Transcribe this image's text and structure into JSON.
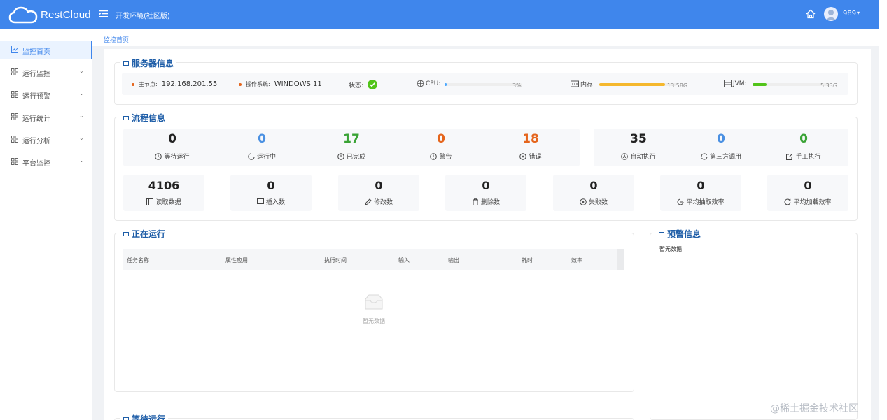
{
  "app": {
    "logo_text": "RestCloud",
    "env_title": "开发环境(社区版)",
    "user": "989"
  },
  "sidebar": {
    "items": [
      {
        "label": "监控首页",
        "active": true
      },
      {
        "label": "运行监控"
      },
      {
        "label": "运行预警"
      },
      {
        "label": "运行统计"
      },
      {
        "label": "运行分析"
      },
      {
        "label": "平台监控"
      }
    ]
  },
  "breadcrumb": "监控首页",
  "server": {
    "title": "服务器信息",
    "master_label": "主节点:",
    "master_value": "192.168.201.55",
    "os_label": "操作系统:",
    "os_value": "WINDOWS 11",
    "status_label": "状态:",
    "cpu_label": "CPU:",
    "cpu_value": "3%",
    "cpu_percent": 3,
    "mem_label": "内存:",
    "mem_value": "13.58G",
    "mem_percent": 85,
    "jvm_label": "JVM:",
    "jvm_value": "5.33G",
    "jvm_percent": 18,
    "colors": {
      "cpu": "#4aa8ff",
      "mem": "#f5b82e",
      "jvm": "#52c41a",
      "ok": "#52c41a"
    }
  },
  "flow": {
    "title": "流程信息",
    "stats_left": [
      {
        "value": "0",
        "label": "等待运行",
        "color": "#222"
      },
      {
        "value": "0",
        "label": "运行中",
        "color": "#4a90e2"
      },
      {
        "value": "17",
        "label": "已完成",
        "color": "#3aa335"
      },
      {
        "value": "0",
        "label": "警告",
        "color": "#e5651c"
      },
      {
        "value": "18",
        "label": "错误",
        "color": "#e5651c"
      }
    ],
    "stats_right": [
      {
        "value": "35",
        "label": "自动执行",
        "color": "#222"
      },
      {
        "value": "0",
        "label": "第三方调用",
        "color": "#4a90e2"
      },
      {
        "value": "0",
        "label": "手工执行",
        "color": "#3aa335"
      }
    ],
    "boxes": [
      {
        "value": "4106",
        "label": "读取数据"
      },
      {
        "value": "0",
        "label": "插入数"
      },
      {
        "value": "0",
        "label": "修改数"
      },
      {
        "value": "0",
        "label": "删除数"
      },
      {
        "value": "0",
        "label": "失败数"
      },
      {
        "value": "0",
        "label": "平均抽取效率"
      },
      {
        "value": "0",
        "label": "平均加载效率"
      }
    ]
  },
  "running": {
    "title": "正在运行",
    "columns": [
      "任务名称",
      "属性应用",
      "执行时间",
      "输入",
      "输出",
      "耗时",
      "效率"
    ],
    "empty_text": "暂无数据"
  },
  "warning": {
    "title": "预警信息",
    "empty_text": "暂无数据"
  },
  "waiting": {
    "title": "等待运行"
  },
  "watermark": "@稀土掘金技术社区"
}
